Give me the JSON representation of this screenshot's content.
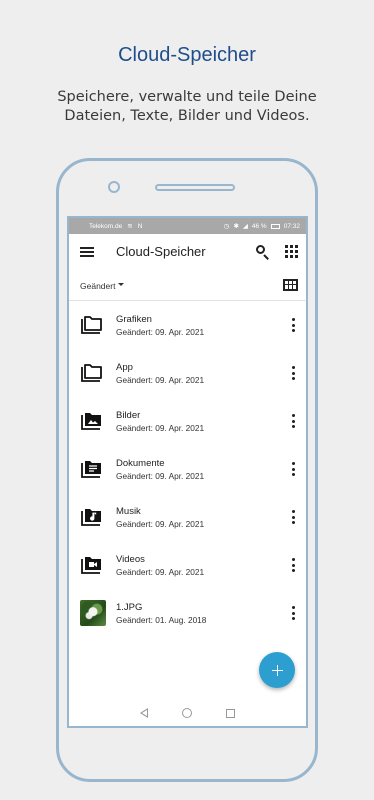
{
  "promo": {
    "title": "Cloud-Speicher",
    "subtitle": "Speichere, verwalte und teile Deine Dateien, Texte, Bilder und Videos."
  },
  "statusbar": {
    "carrier": "Telekom.de",
    "battery": "46 %",
    "time": "07:32"
  },
  "appbar": {
    "title": "Cloud-Speicher",
    "search_icon": "search-icon",
    "apps_icon": "apps-grid-icon",
    "menu_icon": "hamburger-menu-icon"
  },
  "sort": {
    "label": "Geändert",
    "view_toggle_icon": "grid-view-icon"
  },
  "items": [
    {
      "name": "Grafiken",
      "date": "Geändert: 09. Apr. 2021",
      "icon": "folder-icon"
    },
    {
      "name": "App",
      "date": "Geändert: 09. Apr. 2021",
      "icon": "folder-icon"
    },
    {
      "name": "Bilder",
      "date": "Geändert: 09. Apr. 2021",
      "icon": "folder-images-icon"
    },
    {
      "name": "Dokumente",
      "date": "Geändert: 09. Apr. 2021",
      "icon": "folder-documents-icon"
    },
    {
      "name": "Musik",
      "date": "Geändert: 09. Apr. 2021",
      "icon": "folder-music-icon"
    },
    {
      "name": "Videos",
      "date": "Geändert: 09. Apr. 2021",
      "icon": "folder-video-icon"
    },
    {
      "name": "1.JPG",
      "date": "Geändert: 01. Aug. 2018",
      "icon": "image-thumbnail"
    }
  ],
  "fab": {
    "icon": "plus-icon"
  },
  "colors": {
    "accent": "#2c9fd0",
    "promo_title": "#1f4e8c",
    "phone_frame": "#98b6cd",
    "statusbar": "#a8a8a8"
  }
}
